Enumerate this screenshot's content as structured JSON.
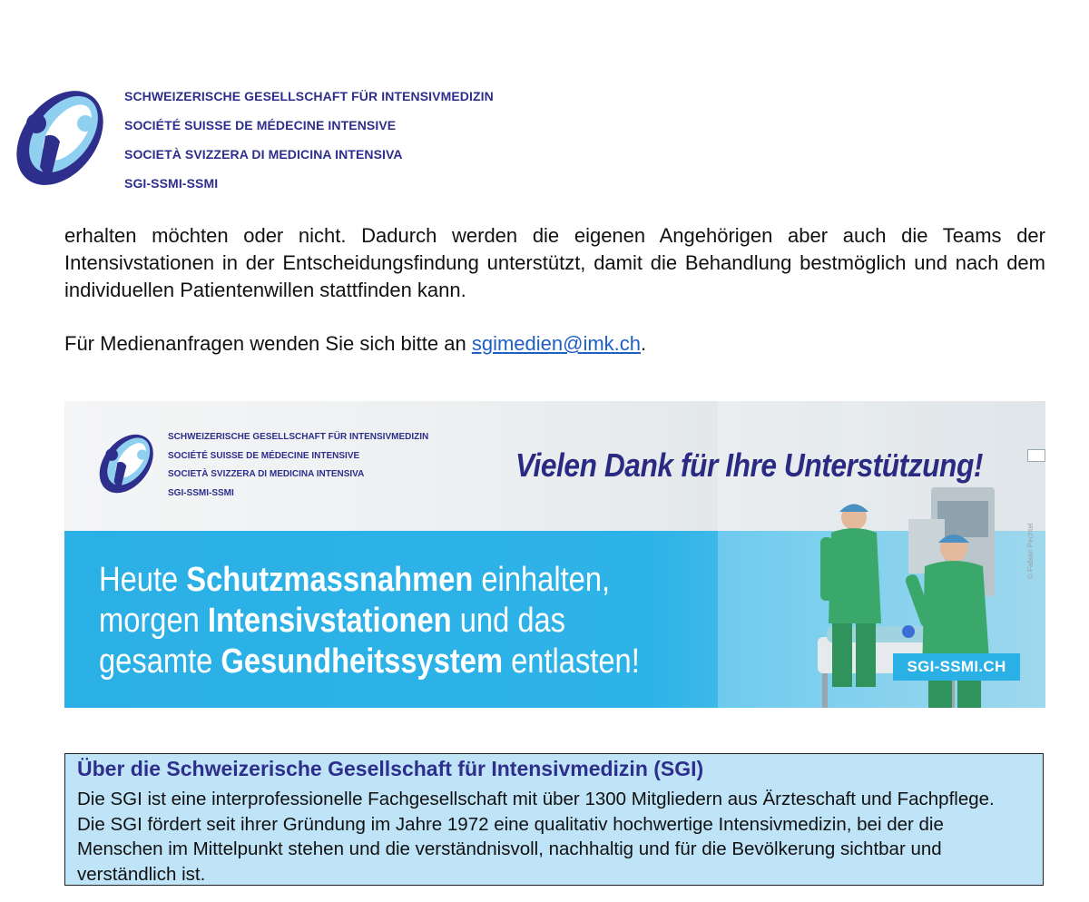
{
  "header": {
    "org_lines": [
      "SCHWEIZERISCHE GESELLSCHAFT FÜR INTENSIVMEDIZIN",
      "SOCIÉTÉ SUISSE DE MÉDECINE INTENSIVE",
      "SOCIETÀ SVIZZERA DI MEDICINA INTENSIVA",
      "SGI-SSMI-SSMI"
    ],
    "logo_icon": "sgi-logo-icon",
    "colors": {
      "brand": "#2e2e8c",
      "light": "#8fd0f0"
    }
  },
  "body": {
    "paragraph": "erhalten möchten oder nicht. Dadurch werden die eigenen Angehörigen aber auch die Teams der Intensivstationen in der Entscheidungsfindung unterstützt, damit die Behandlung bestmöglich und nach dem individuellen Patientenwillen stattfinden kann.",
    "media_prefix": "Für Medienanfragen wenden Sie sich bitte an ",
    "media_email": "sgimedien@imk.ch",
    "media_suffix": "."
  },
  "banner": {
    "org_lines": [
      "SCHWEIZERISCHE GESELLSCHAFT FÜR INTENSIVMEDIZIN",
      "SOCIÉTÉ SUISSE DE MÉDECINE INTENSIVE",
      "SOCIETÀ SVIZZERA DI MEDICINA INTENSIVA",
      "SGI-SSMI-SSMI"
    ],
    "thanks": "Vielen Dank für Ihre Unterstützung!",
    "slogan": [
      {
        "a": "Heute ",
        "b": "Schutzmassnahmen",
        "c": " einhalten,"
      },
      {
        "a": "morgen ",
        "b": "Intensivstationen",
        "c": " und das"
      },
      {
        "a": "gesamte ",
        "b": "Gesundheitssystem",
        "c": " entlasten!"
      }
    ],
    "site": "SGI-SSMI.CH",
    "credit": "© Fabian Pechtel",
    "colors": {
      "blue": "#2bb0e6",
      "scrubs": "#3aa86b"
    }
  },
  "about": {
    "title": "Über die Schweizerische Gesellschaft für Intensivmedizin (SGI)",
    "text": "Die SGI ist eine interprofessionelle Fachgesellschaft mit über 1300 Mitgliedern aus Ärzteschaft und Fachpflege. Die SGI fördert seit ihrer Gründung im Jahre 1972 eine qualitativ hochwertige Intensivmedizin, bei der die Menschen im Mittelpunkt stehen und die verständnisvoll, nachhaltig und für die Bevölkerung sichtbar und verständlich ist.",
    "colors": {
      "background": "#bfe3f7",
      "title": "#2e2e8c"
    }
  }
}
